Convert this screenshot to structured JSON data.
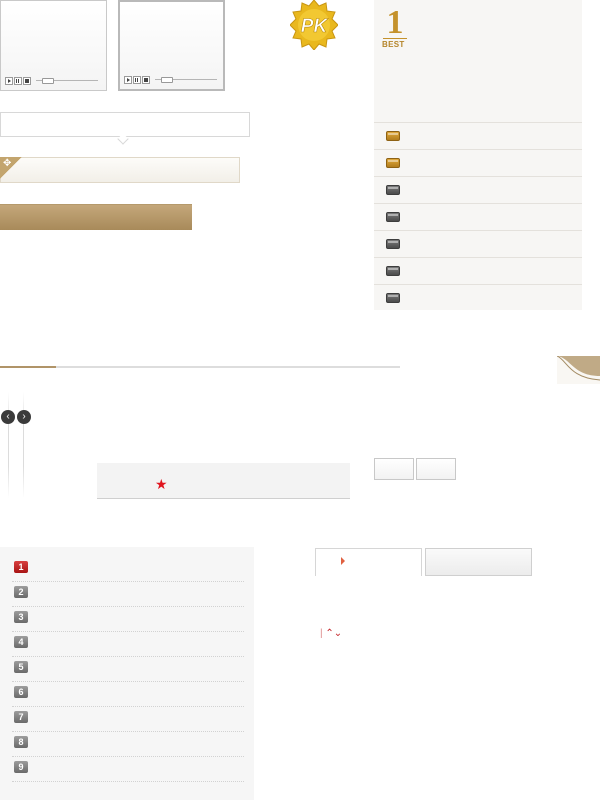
{
  "pk_badge": {
    "label": "PK",
    "color": "#e9b81e"
  },
  "best_panel": {
    "rank_digit": "1",
    "label": "BEST",
    "accent": "#c4922c",
    "rows": [
      {
        "folder": "gold"
      },
      {
        "folder": "gold"
      },
      {
        "folder": "grey"
      },
      {
        "folder": "grey"
      },
      {
        "folder": "grey"
      },
      {
        "folder": "grey"
      },
      {
        "folder": "grey"
      }
    ]
  },
  "progress": {
    "fraction": 0.14,
    "fill_color": "#b09468"
  },
  "navigation": {
    "prev_icon": "chevron-left-icon",
    "next_icon": "chevron-right-icon"
  },
  "rating": {
    "icon": "star-icon",
    "color": "#e0141e"
  },
  "ranking_list": {
    "items": [
      "1",
      "2",
      "3",
      "4",
      "5",
      "6",
      "7",
      "8",
      "9"
    ]
  },
  "sorter": {
    "up_icon": "chevron-up-icon",
    "down_icon": "chevron-down-icon"
  }
}
